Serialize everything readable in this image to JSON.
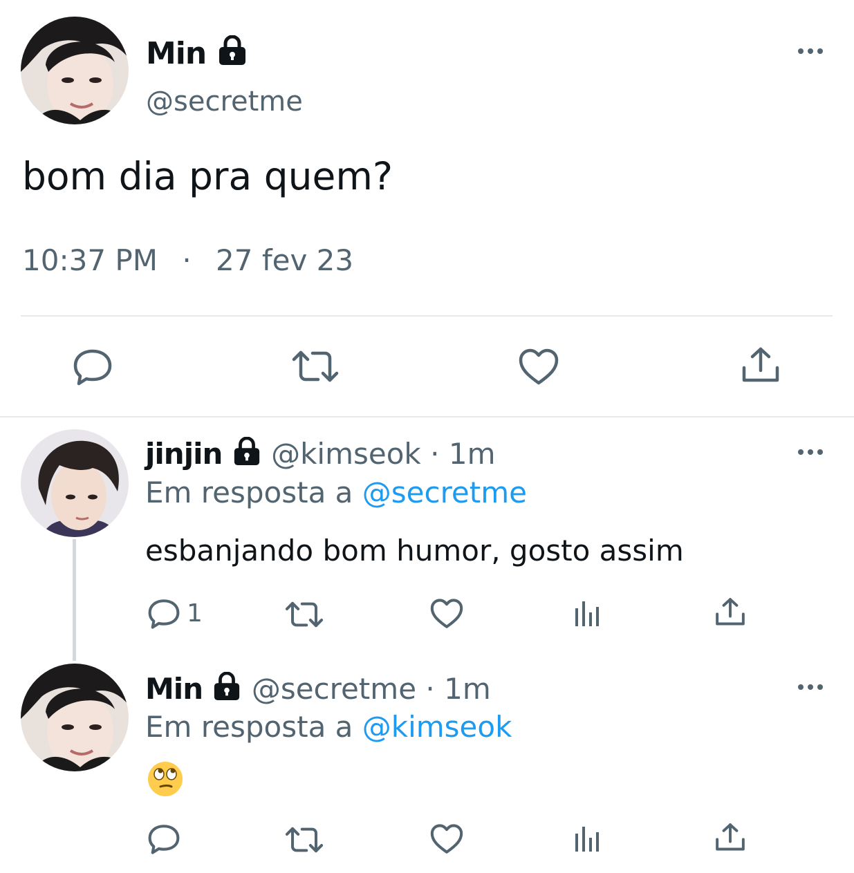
{
  "main_tweet": {
    "author_name": "Min",
    "author_handle": "@secretme",
    "text": "bom dia pra quem?",
    "time": "10:37 PM",
    "separator": "·",
    "date": "27 fev 23"
  },
  "replies": [
    {
      "author_name": "jinjin",
      "author_handle": "@kimseok",
      "meta_sep": "·",
      "age": "1m",
      "reply_prefix": "Em resposta a",
      "reply_to": "@secretme",
      "text": "esbanjando bom humor, gosto assim",
      "reply_count": "1"
    },
    {
      "author_name": "Min",
      "author_handle": "@secretme",
      "meta_sep": "·",
      "age": "1m",
      "reply_prefix": "Em resposta a",
      "reply_to": "@kimseok",
      "emoji": "🙄"
    }
  ],
  "icons": {
    "reply": "reply-icon",
    "retweet": "retweet-icon",
    "like": "heart-icon",
    "views": "views-icon",
    "share": "share-icon",
    "more": "more-icon",
    "lock": "lock-icon"
  },
  "colors": {
    "text": "#0f1419",
    "secondary": "#536471",
    "link": "#1d9bf0",
    "divider": "#e6e9eb",
    "thread_line": "#cfd9de"
  }
}
